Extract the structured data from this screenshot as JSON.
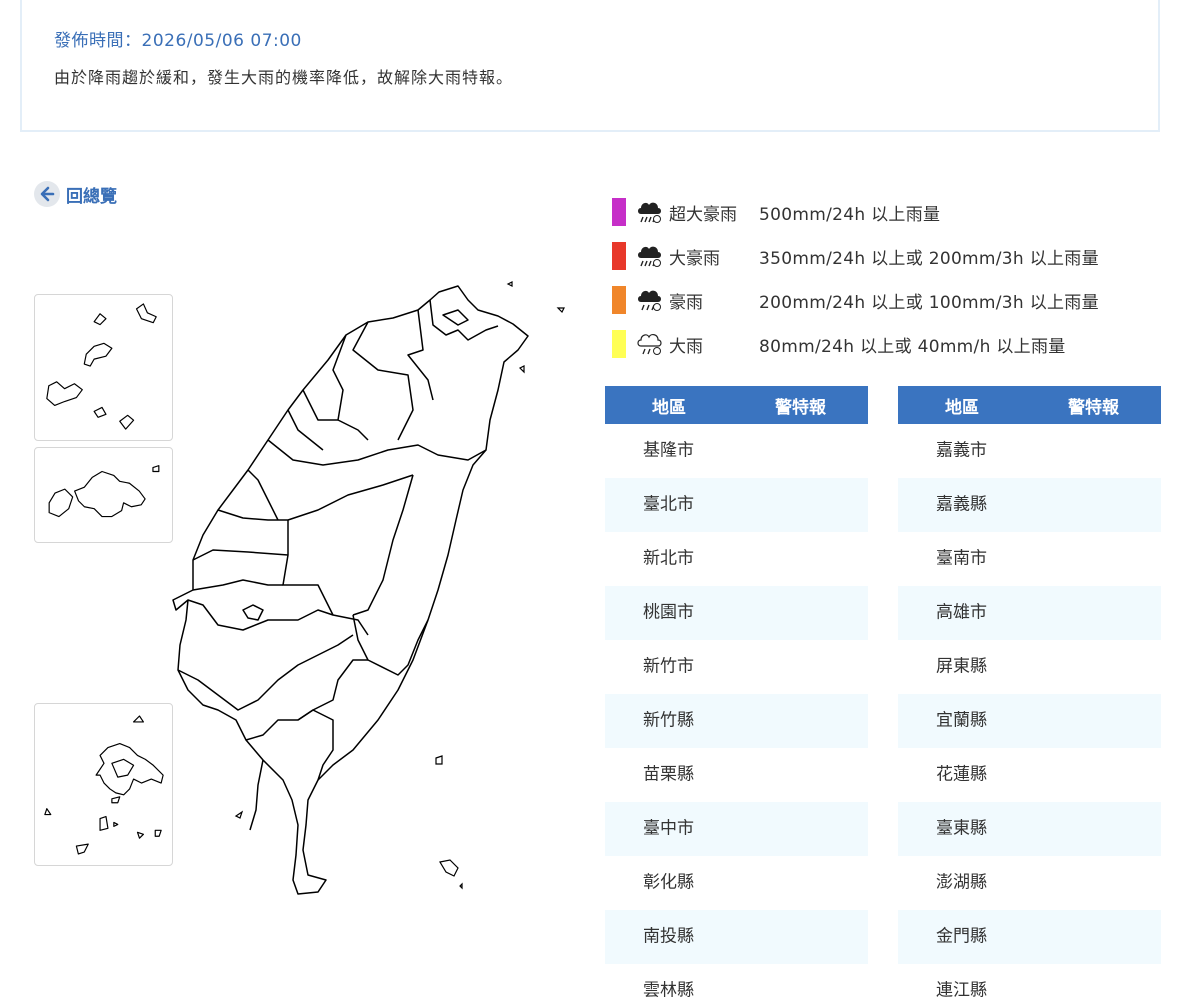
{
  "notice": {
    "time": "發佈時間：2026/05/06 07:00",
    "text": "由於降雨趨於緩和，發生大雨的機率降低，故解除大雨特報。"
  },
  "nav": {
    "back_label": "回總覽",
    "back_icon": "arrow-left-icon"
  },
  "legend": [
    {
      "name": "超大豪雨",
      "desc": "500mm/24h 以上雨量",
      "color": "#c62fc8",
      "icon": "heavy-rain-cloud-icon"
    },
    {
      "name": "大豪雨",
      "desc": "350mm/24h 以上或 200mm/3h 以上雨量",
      "color": "#e8382a",
      "icon": "heavy-rain-cloud-icon"
    },
    {
      "name": "豪雨",
      "desc": "200mm/24h 以上或 100mm/3h 以上雨量",
      "color": "#f0862a",
      "icon": "heavy-rain-cloud-icon"
    },
    {
      "name": "大雨",
      "desc": "80mm/24h 以上或 40mm/h 以上雨量",
      "color": "#ffff55",
      "icon": "rain-cloud-outline-icon"
    }
  ],
  "table": {
    "header_region": "地區",
    "header_warning": "警特報",
    "left": [
      {
        "region": "基隆市",
        "warning": ""
      },
      {
        "region": "臺北市",
        "warning": ""
      },
      {
        "region": "新北市",
        "warning": ""
      },
      {
        "region": "桃園市",
        "warning": ""
      },
      {
        "region": "新竹市",
        "warning": ""
      },
      {
        "region": "新竹縣",
        "warning": ""
      },
      {
        "region": "苗栗縣",
        "warning": ""
      },
      {
        "region": "臺中市",
        "warning": ""
      },
      {
        "region": "彰化縣",
        "warning": ""
      },
      {
        "region": "南投縣",
        "warning": ""
      },
      {
        "region": "雲林縣",
        "warning": ""
      }
    ],
    "right": [
      {
        "region": "嘉義市",
        "warning": ""
      },
      {
        "region": "嘉義縣",
        "warning": ""
      },
      {
        "region": "臺南市",
        "warning": ""
      },
      {
        "region": "高雄市",
        "warning": ""
      },
      {
        "region": "屏東縣",
        "warning": ""
      },
      {
        "region": "宜蘭縣",
        "warning": ""
      },
      {
        "region": "花蓮縣",
        "warning": ""
      },
      {
        "region": "臺東縣",
        "warning": ""
      },
      {
        "region": "澎湖縣",
        "warning": ""
      },
      {
        "region": "金門縣",
        "warning": ""
      },
      {
        "region": "連江縣",
        "warning": ""
      }
    ]
  }
}
